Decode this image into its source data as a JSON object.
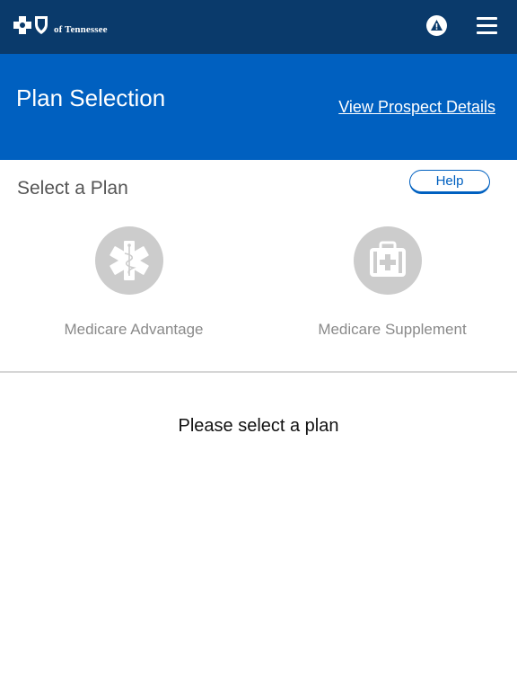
{
  "topbar": {
    "logo_text": "of Tennessee",
    "logo_icon": "blue-cross-blue-shield-icon",
    "alert_icon": "alert-triangle-icon",
    "menu_icon": "hamburger-menu-icon"
  },
  "header": {
    "title": "Plan Selection",
    "prospect_link": "View Prospect Details"
  },
  "section": {
    "title": "Select a Plan",
    "help_label": "Help"
  },
  "plans": [
    {
      "label": "Medicare Advantage",
      "icon": "medical-star-of-life-icon"
    },
    {
      "label": "Medicare Supplement",
      "icon": "first-aid-kit-icon"
    }
  ],
  "prompt": "Please select a plan",
  "colors": {
    "topbar": "#0a3a6b",
    "header": "#0060c0",
    "plan_icon_bg": "#cccccc",
    "plan_label": "#8a8a8a"
  }
}
